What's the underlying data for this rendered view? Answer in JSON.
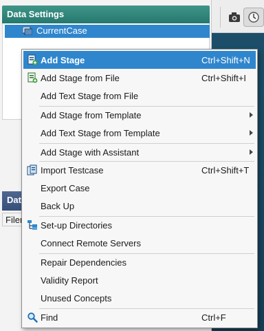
{
  "panel": {
    "title": "Data Settings",
    "tree_item": "CurrentCase"
  },
  "lower_panel": {
    "title": "Data",
    "tab": "Filen"
  },
  "menu": {
    "items": [
      {
        "label": "Add Stage",
        "shortcut": "Ctrl+Shift+N",
        "icon": "add-stage-icon"
      },
      {
        "label": "Add Stage from File",
        "shortcut": "Ctrl+Shift+I",
        "icon": "add-stage-file-icon"
      },
      {
        "label": "Add Text Stage from File",
        "shortcut": ""
      },
      {
        "label": "Add Stage from Template",
        "shortcut": ""
      },
      {
        "label": "Add Text Stage from Template",
        "shortcut": ""
      },
      {
        "label": "Add Stage with Assistant",
        "shortcut": ""
      },
      {
        "label": "Import Testcase",
        "shortcut": "Ctrl+Shift+T",
        "icon": "import-icon"
      },
      {
        "label": "Export Case",
        "shortcut": ""
      },
      {
        "label": "Back Up",
        "shortcut": ""
      },
      {
        "label": "Set-up Directories",
        "shortcut": "",
        "icon": "directories-icon"
      },
      {
        "label": "Connect Remote Servers",
        "shortcut": ""
      },
      {
        "label": "Repair Dependencies",
        "shortcut": ""
      },
      {
        "label": "Validity Report",
        "shortcut": ""
      },
      {
        "label": "Unused Concepts",
        "shortcut": ""
      },
      {
        "label": "Find",
        "shortcut": "Ctrl+F",
        "icon": "search-icon"
      }
    ]
  },
  "colors": {
    "highlight": "#2f86cd",
    "panel_header": "#26786d"
  }
}
